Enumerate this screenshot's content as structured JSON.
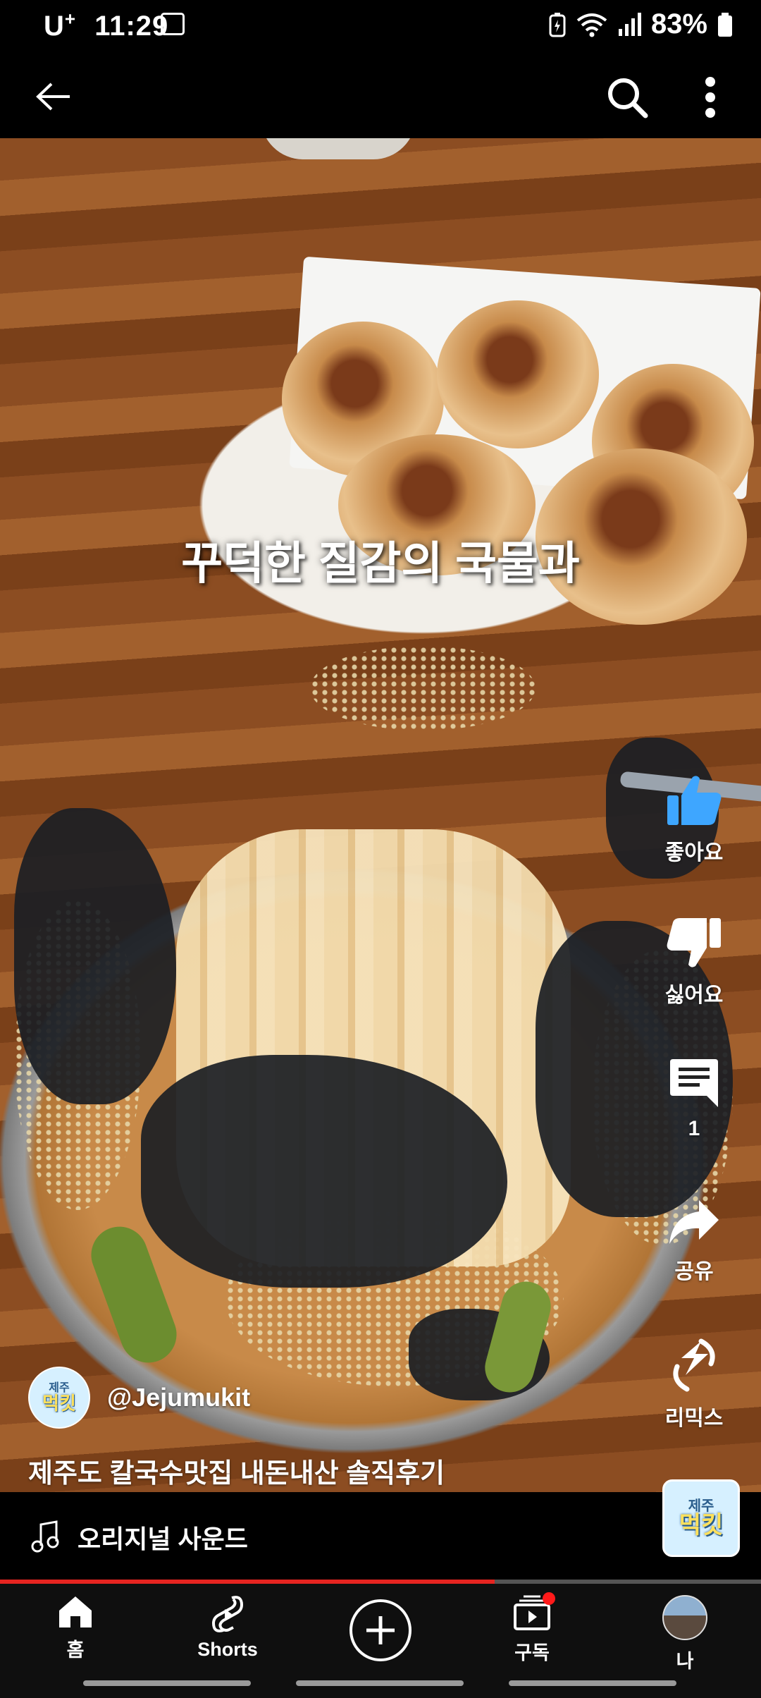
{
  "status_bar": {
    "carrier": "U",
    "carrier_sup": "+",
    "time": "11:29",
    "battery": "83%"
  },
  "top_bar": {
    "back_icon": "arrow-left-icon",
    "search_icon": "search-icon",
    "more_icon": "more-vert-icon"
  },
  "video": {
    "caption": "꾸덕한 질감의 국물과"
  },
  "actions": {
    "like_label": "좋아요",
    "dislike_label": "싫어요",
    "comments_count": "1",
    "share_label": "공유",
    "remix_label": "리믹스"
  },
  "channel": {
    "avatar_text": "먹킷",
    "avatar_small_text": "제주",
    "handle": "@Jejumukit"
  },
  "video_title": "제주도 칼국수맛집 내돈내산 솔직후기",
  "sound": {
    "label": "오리지널 사운드",
    "thumb_text": "먹킷",
    "thumb_small_text": "제주"
  },
  "progress": 0.65,
  "nav": {
    "home_label": "홈",
    "shorts_label": "Shorts",
    "subscriptions_label": "구독",
    "you_label": "나"
  },
  "colors": {
    "accent_red": "#e52420",
    "like_blue": "#3ea6ff"
  }
}
